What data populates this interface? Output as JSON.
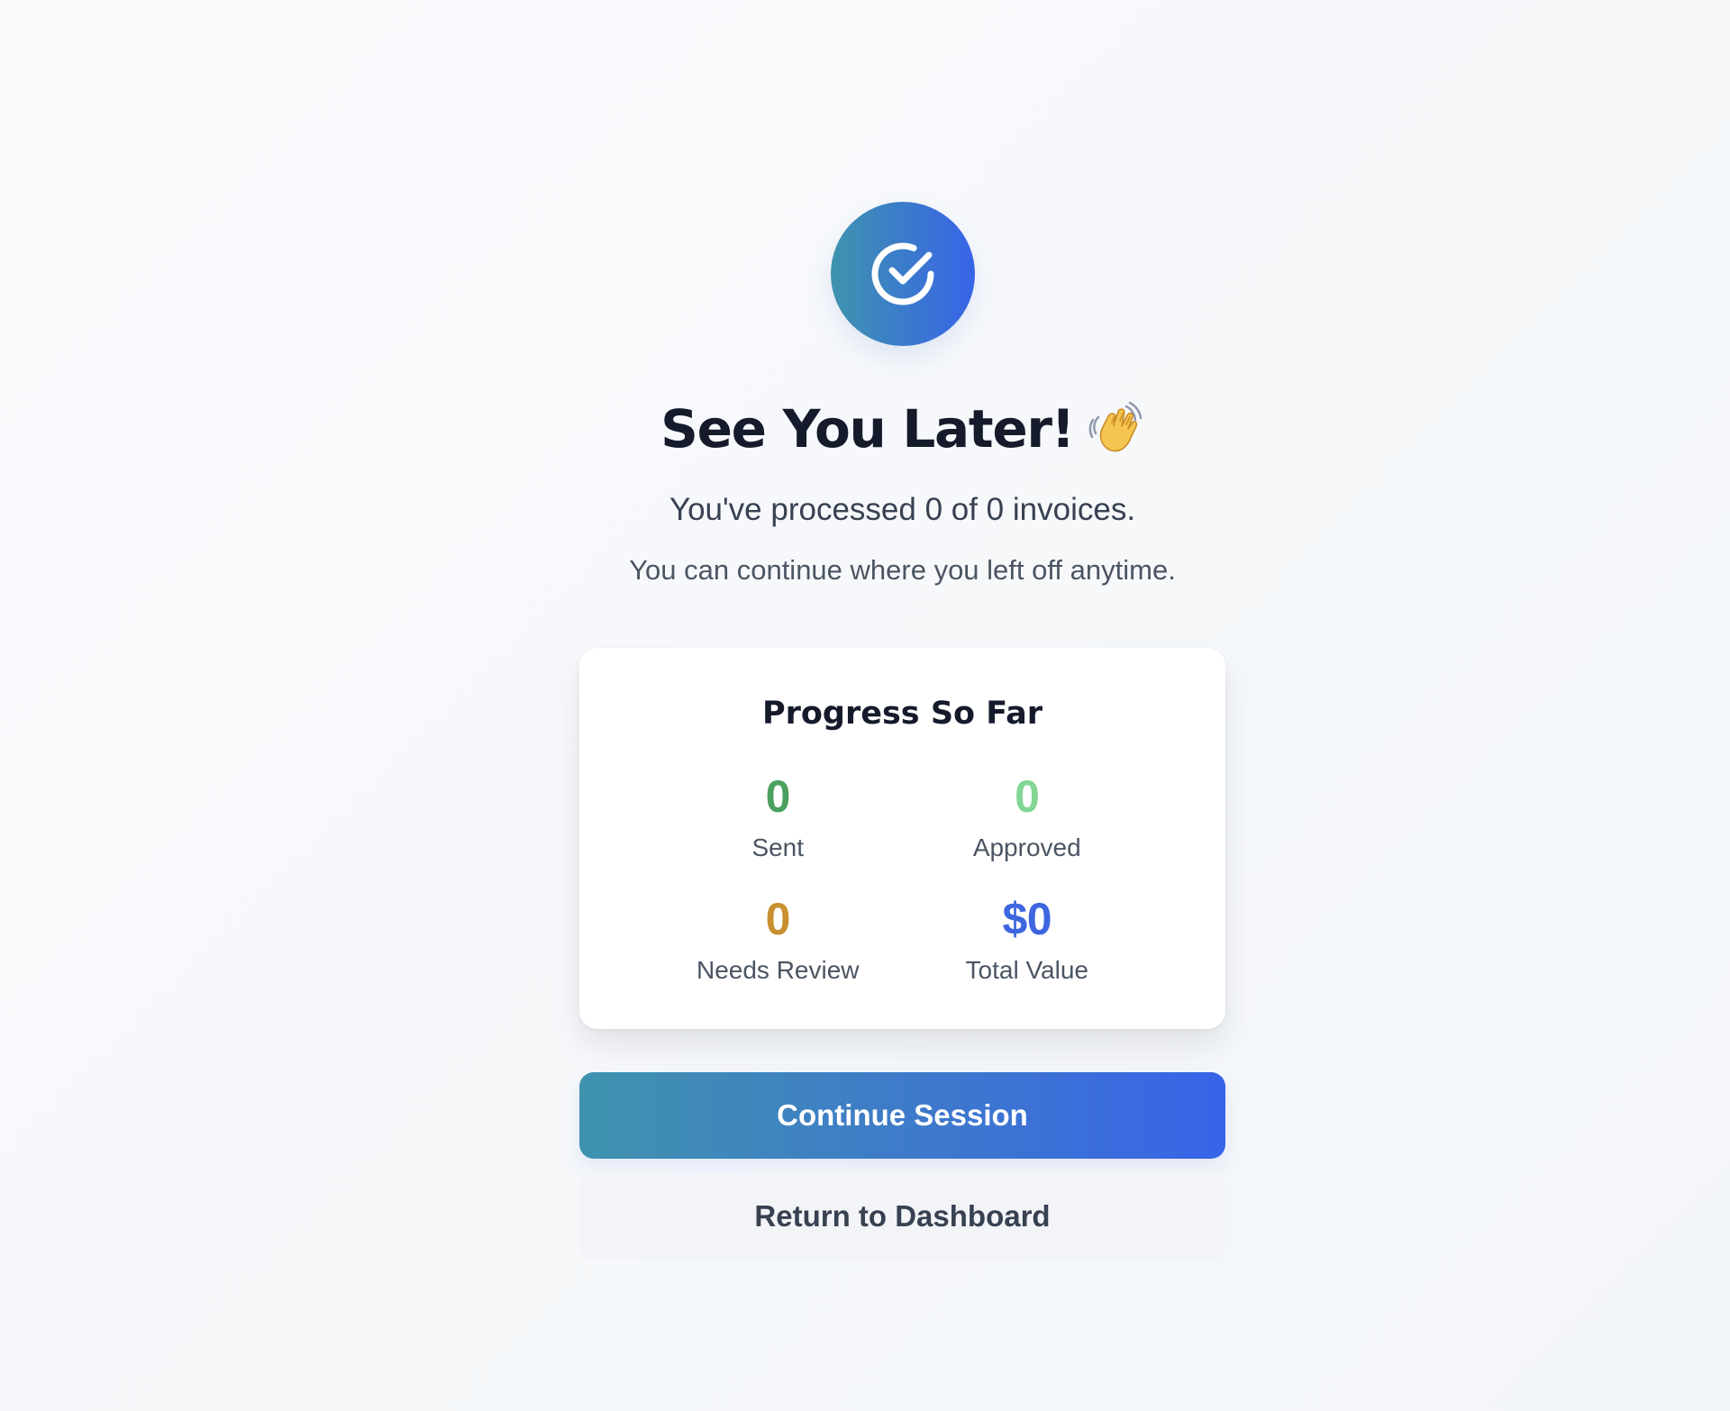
{
  "icons": {
    "status": "check-circle-icon",
    "headline": "waving-hand-icon"
  },
  "colors": {
    "primary_gradient_start": "#3f93ae",
    "primary_gradient_end": "#3764e8",
    "sent": "#4aa05e",
    "approved": "#82d693",
    "needs_review": "#c8902f",
    "total_value": "#3d66df",
    "heading": "#151b2b"
  },
  "headline": {
    "text": "See You Later!"
  },
  "message": {
    "summary": "You've processed 0 of 0 invoices.",
    "followup": "You can continue where you left off anytime."
  },
  "progress_card": {
    "title": "Progress So Far",
    "stats": [
      {
        "value": "0",
        "label": "Sent"
      },
      {
        "value": "0",
        "label": "Approved"
      },
      {
        "value": "0",
        "label": "Needs Review"
      },
      {
        "value": "$0",
        "label": "Total Value"
      }
    ]
  },
  "actions": {
    "primary_label": "Continue Session",
    "secondary_label": "Return to Dashboard"
  }
}
